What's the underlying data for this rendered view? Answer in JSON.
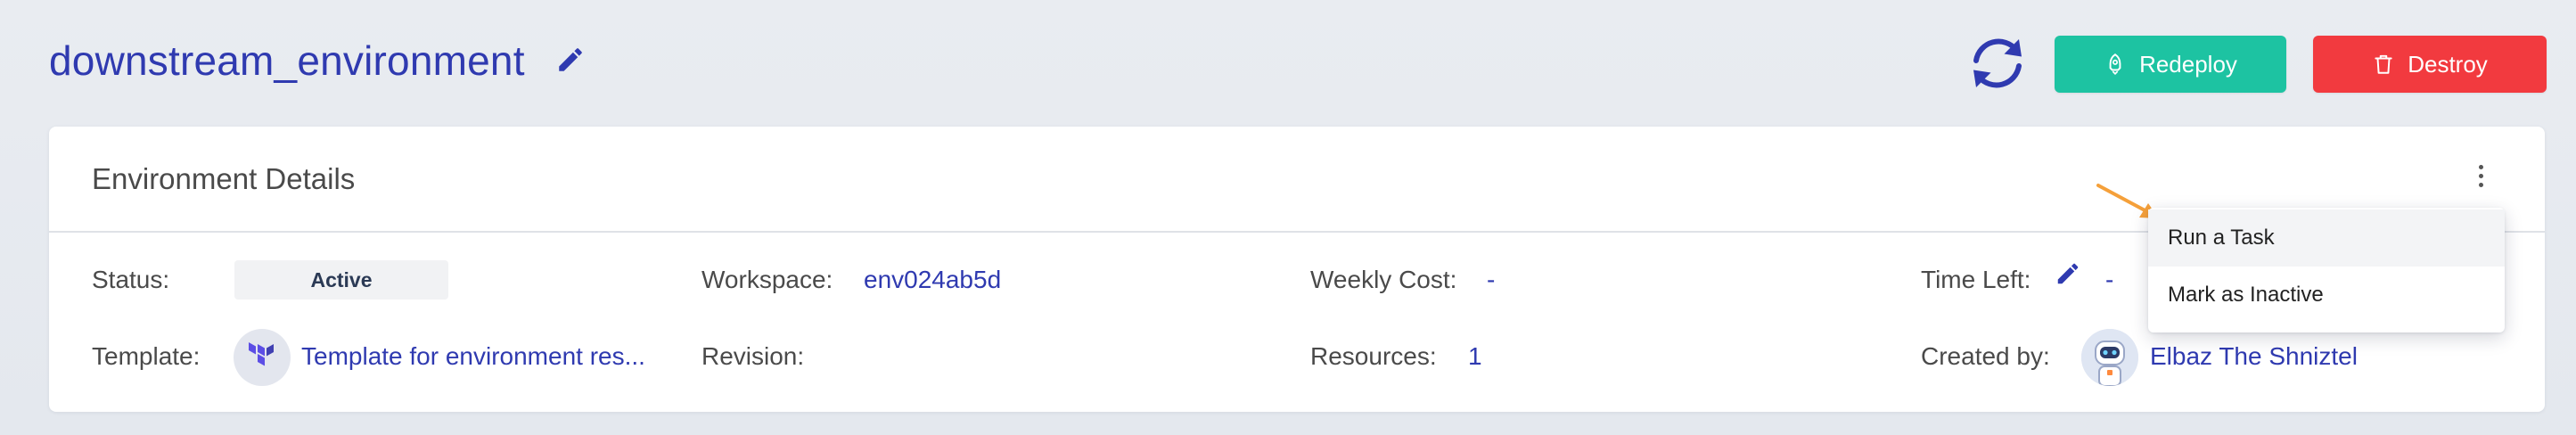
{
  "header": {
    "title": "downstream_environment",
    "redeploy_label": "Redeploy",
    "destroy_label": "Destroy"
  },
  "card": {
    "title": "Environment Details",
    "fields": {
      "status_label": "Status:",
      "status_value": "Active",
      "template_label": "Template:",
      "template_value": "Template for environment res...",
      "workspace_label": "Workspace:",
      "workspace_value": "env024ab5d",
      "revision_label": "Revision:",
      "weekly_cost_label": "Weekly Cost:",
      "weekly_cost_value": "-",
      "resources_label": "Resources:",
      "resources_value": "1",
      "time_left_label": "Time Left:",
      "time_left_value": "-",
      "created_by_label": "Created by:",
      "created_by_value": "Elbaz The Shniztel"
    }
  },
  "menu": {
    "items": [
      "Run a Task",
      "Mark as Inactive"
    ]
  },
  "colors": {
    "accent": "#2f3ab0",
    "redeploy": "#1dc3a2",
    "destroy": "#f23a3f",
    "annotation_arrow": "#f5a03a"
  },
  "icons": {
    "title_edit": "pencil-icon",
    "refresh": "refresh-icon",
    "redeploy": "rocket-icon",
    "destroy": "trash-icon",
    "more": "kebab-menu-icon",
    "template": "terraform-logo-icon",
    "avatar": "robot-avatar-icon"
  }
}
